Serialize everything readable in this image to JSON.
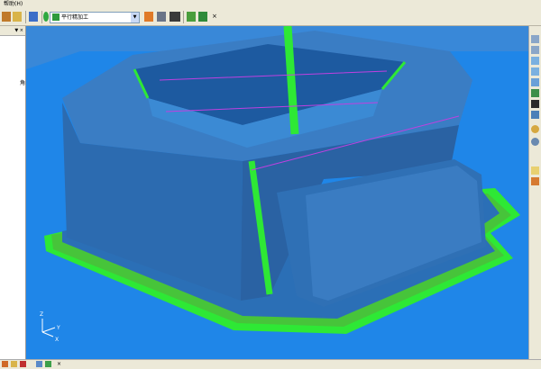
{
  "menu": {
    "help_label": "帮助(H)"
  },
  "toolbar": {
    "strategy_combo": {
      "value": "平行精加工",
      "icon": "raster-finish-icon"
    },
    "close_label": "×"
  },
  "left_panel": {
    "header_label": "▼ ×",
    "item_label": "角"
  },
  "icons": [
    "save-icon",
    "tool-icon",
    "calculator-icon",
    "ruler-icon",
    "zoom-icon",
    "simulation-icon",
    "shade-icon",
    "pan-icon"
  ],
  "colors": {
    "background": "#1e7fd6",
    "model_face": "#2f6fb0",
    "toolpath_green": "#2ee835",
    "toolpath_magenta": "#c040e0",
    "ui_face": "#ece9d8"
  },
  "axis": {
    "x": "X",
    "y": "Y",
    "z": "Z"
  }
}
